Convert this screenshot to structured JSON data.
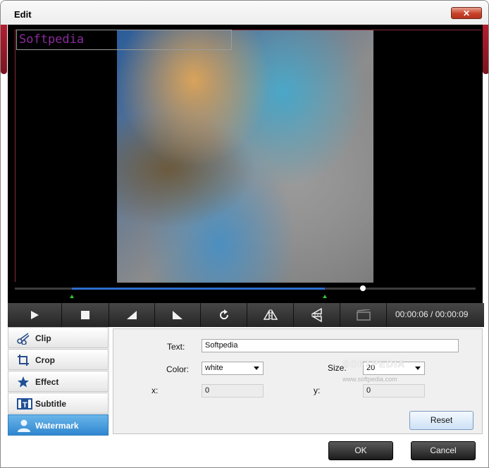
{
  "window": {
    "title": "Edit",
    "close_label": "✕"
  },
  "preview": {
    "watermark_text": "Softpedia"
  },
  "timeline": {
    "position_fraction": 0.755,
    "progress_start_fraction": 0.124,
    "progress_end_fraction": 0.673
  },
  "toolbar": {
    "buttons": [
      "play-icon",
      "stop-icon",
      "fade-in-icon",
      "fade-out-icon",
      "rotate-icon",
      "flip-horizontal-icon",
      "flip-vertical-icon",
      "crop-frame-icon"
    ],
    "timecode": "00:00:06 / 00:00:09"
  },
  "tabs": [
    {
      "label": "Clip",
      "icon": "scissors-icon"
    },
    {
      "label": "Crop",
      "icon": "crop-icon"
    },
    {
      "label": "Effect",
      "icon": "star-icon"
    },
    {
      "label": "Subtitle",
      "icon": "subtitle-icon"
    },
    {
      "label": "Watermark",
      "icon": "person-icon",
      "active": true
    }
  ],
  "watermark_panel": {
    "text_label": "Text:",
    "text_value": "Softpedia",
    "color_label": "Color:",
    "color_value": "white",
    "size_label": "Size:",
    "size_value": "20",
    "x_label": "x:",
    "x_value": "0",
    "y_label": "y:",
    "y_value": "0",
    "reset_label": "Reset"
  },
  "screenshot_watermark": {
    "logo": "SOFTPEDIA",
    "url": "www.softpedia.com"
  },
  "footer": {
    "ok_label": "OK",
    "cancel_label": "Cancel"
  },
  "colors": {
    "accent": "#2f86cf",
    "close": "#c8412a",
    "progress": "#2c6fd1"
  }
}
